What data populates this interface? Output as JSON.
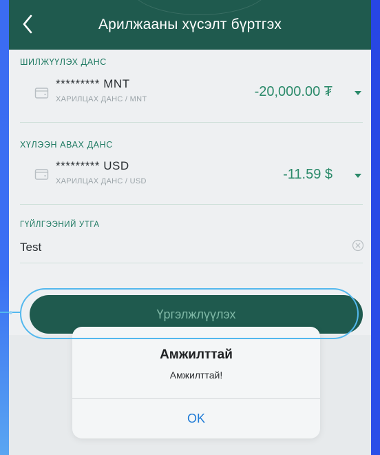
{
  "header": {
    "title": "Арилжааны хүсэлт бүртгэх",
    "back_icon": "chevron-left-icon"
  },
  "from_account": {
    "label": "ШИЛЖҮҮЛЭХ ДАНС",
    "number": "********* MNT",
    "subtitle": "ХАРИЛЦАХ ДАНС / MNT",
    "amount": "-20,000.00 ₮",
    "icon": "wallet-icon"
  },
  "to_account": {
    "label": "ХҮЛЭЭН АВАХ ДАНС",
    "number": "********* USD",
    "subtitle": "ХАРИЛЦАХ ДАНС / USD",
    "amount": "-11.59 $",
    "icon": "wallet-icon"
  },
  "description": {
    "label": "ГҮЙЛГЭЭНИЙ УТГА",
    "value": "Test",
    "clear_icon": "clear-icon"
  },
  "continue_button": {
    "label": "Үргэлжлүүлэх"
  },
  "alert": {
    "title": "Амжилттай",
    "message": "Амжилттай!",
    "ok_label": "OK"
  },
  "colors": {
    "header_bg": "#1f5a4e",
    "accent_green": "#2b8a6a",
    "callout_blue": "#53b8ee",
    "ok_blue": "#1f7bd6",
    "background_blue": "#2f4eea"
  }
}
